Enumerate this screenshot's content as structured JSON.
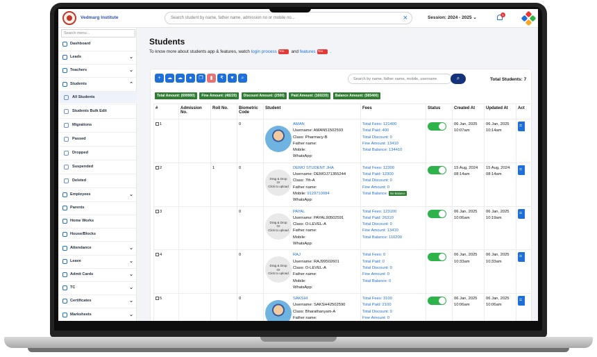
{
  "header": {
    "institute_name": "Vedmarg Institute",
    "search_placeholder": "Search student by name, father name, admission no or mobile no...",
    "session_label": "Session:",
    "session_value": "2024 - 2025",
    "notification_count": "1"
  },
  "sidebar": {
    "search_placeholder": "Search menu...",
    "items": [
      {
        "label": "Dashboard",
        "icon": "dashboard-icon",
        "expandable": false
      },
      {
        "label": "Leads",
        "icon": "leads-icon",
        "expandable": true
      },
      {
        "label": "Teachers",
        "icon": "teachers-icon",
        "expandable": true
      },
      {
        "label": "Students",
        "icon": "students-icon",
        "expandable": true,
        "expanded": true
      },
      {
        "label": "All Students",
        "icon": "list-icon",
        "sub": true,
        "active": true
      },
      {
        "label": "Students Bulk Edit",
        "icon": "edit-icon",
        "sub": true
      },
      {
        "label": "Migrations",
        "icon": "migration-icon",
        "sub": true
      },
      {
        "label": "Passed",
        "icon": "passed-icon",
        "sub": true
      },
      {
        "label": "Dropped",
        "icon": "dropped-icon",
        "sub": true
      },
      {
        "label": "Suspended",
        "icon": "suspended-icon",
        "sub": true
      },
      {
        "label": "Deleted",
        "icon": "deleted-icon",
        "sub": true
      },
      {
        "label": "Employees",
        "icon": "employees-icon",
        "expandable": true
      },
      {
        "label": "Parents",
        "icon": "parents-icon",
        "expandable": false
      },
      {
        "label": "Home Works",
        "icon": "homework-icon",
        "expandable": false
      },
      {
        "label": "House/Blocks",
        "icon": "house-icon",
        "expandable": false
      },
      {
        "label": "Attendance",
        "icon": "attendance-icon",
        "expandable": true
      },
      {
        "label": "Leave",
        "icon": "leave-icon",
        "expandable": true
      },
      {
        "label": "Admit Cards",
        "icon": "admit-card-icon",
        "expandable": true
      },
      {
        "label": "TC",
        "icon": "tc-icon",
        "expandable": true
      },
      {
        "label": "Certificates",
        "icon": "certificates-icon",
        "expandable": true
      },
      {
        "label": "Marksheets",
        "icon": "marksheets-icon",
        "expandable": true
      }
    ]
  },
  "page": {
    "title": "Students",
    "subtitle_prefix": "To know more about students app & features, watch",
    "login_process_link": "login process",
    "and_text": "and",
    "features_link": "features",
    "subtitle_suffix": "."
  },
  "toolbar": {
    "table_search_placeholder": "Search by name, father name, mobile, username",
    "total_students_label": "Total Students:",
    "total_students_value": "7"
  },
  "summary_badges": [
    "Total Amount: (699900)",
    "Fine Amount: (48220)",
    "Discount Amount: (2500)",
    "Paid Amount: (160220)",
    "Balance Amount: (585400)"
  ],
  "table": {
    "headers": [
      "#",
      "Admission No.",
      "Roll No.",
      "Biometric Code",
      "Student",
      "Fees",
      "Status",
      "Created At",
      "Updated At",
      "Act"
    ],
    "photo_placeholder": [
      "Drag & Drop",
      "Or",
      "Click to upload"
    ],
    "rows": [
      {
        "num": "1",
        "admission_no": "",
        "roll_no": "",
        "biometric": "0",
        "has_photo": true,
        "name": "AMAN",
        "username": "Username: AMAN51502593",
        "class": "Class: Pharmacy-B",
        "father": "Father name:",
        "mobile_label": "Mobile:",
        "mobile": "",
        "whatsapp": "WhatsApp:",
        "fees": [
          "Total Fees: 121400",
          "Total Paid: 400",
          "Total Discount: 0",
          "Fine Amount: 13410",
          "Total Balance: 134410"
        ],
        "no_balance": false,
        "status": true,
        "created": [
          "06 Jan, 2025",
          "10:07am"
        ],
        "updated": [
          "06 Jan, 2025",
          "10:14am"
        ]
      },
      {
        "num": "2",
        "admission_no": "",
        "roll_no": "1",
        "biometric": "0",
        "has_photo": false,
        "name": "DEMO STUDENT JHA",
        "username": "Username: DEMOJ71355244",
        "class": "Class: 7th-A",
        "father": "Father name:",
        "mobile_label": "Mobile:",
        "mobile": "9129710084",
        "whatsapp": "WhatsApp:",
        "fees": [
          "Total Fees: 12300",
          "Total Paid: 12300",
          "Total Discount: 0",
          "Fine Amount: 0",
          "Total Balance:"
        ],
        "no_balance": true,
        "no_balance_label": "No Balance",
        "status": true,
        "created": [
          "15 Aug, 2024",
          "08:14am"
        ],
        "updated": [
          "15 Aug, 2024",
          "08:14am"
        ]
      },
      {
        "num": "3",
        "admission_no": "",
        "roll_no": "",
        "biometric": "0",
        "has_photo": false,
        "name": "PAYAL",
        "username": "Username: PAYAL90502591",
        "class": "Class: O-LEVEL-A",
        "father": "Father name:",
        "mobile_label": "Mobile:",
        "mobile": "",
        "whatsapp": "WhatsApp:",
        "fees": [
          "Total Fees: 123100",
          "Total Paid: 26310",
          "Total Discount: 0",
          "Fine Amount: 13410",
          "Total Balance: 110200"
        ],
        "no_balance": false,
        "status": true,
        "created": [
          "06 Jan, 2025",
          "10:06am"
        ],
        "updated": [
          "06 Jan, 2025",
          "10:19am"
        ]
      },
      {
        "num": "4",
        "admission_no": "",
        "roll_no": "",
        "biometric": "0",
        "has_photo": false,
        "name": "RAJ",
        "username": "Username: RAJ99502601",
        "class": "Class: O-LEVEL-A",
        "father": "Father name:",
        "mobile_label": "Mobile:",
        "mobile": "",
        "whatsapp": "WhatsApp:",
        "fees": [
          "Total Fees: 0",
          "Total Paid: 0",
          "Total Discount: 0",
          "Fine Amount: 0",
          "Total Balance: 0"
        ],
        "no_balance": false,
        "status": true,
        "created": [
          "06 Jan, 2025",
          "10:33am"
        ],
        "updated": [
          "06 Jan, 2025",
          "10:33am"
        ]
      },
      {
        "num": "5",
        "admission_no": "",
        "roll_no": "",
        "biometric": "0",
        "has_photo": true,
        "name": "SAKSHI",
        "username": "Username: SAKSH42502590",
        "class": "Class: Bharathanyam-A",
        "father": "Father name:",
        "mobile_label": "Mobile:",
        "mobile": "",
        "whatsapp": "WhatsApp:",
        "fees": [
          "Total Fees: 3100",
          "Total Paid: 2100",
          "Total Discount: 0",
          "Fine Amount: 0",
          "Total Balance: 1000"
        ],
        "no_balance": false,
        "status": true,
        "created": [
          "06 Jan, 2025",
          "10:06am"
        ],
        "updated": [
          "06 Jan, 2025",
          "10:06am"
        ]
      }
    ]
  },
  "colors": {
    "primary": "#1e6fd9",
    "success": "#2e7d32",
    "toggle_on": "#2db34a",
    "dark_navy": "#14337a"
  }
}
